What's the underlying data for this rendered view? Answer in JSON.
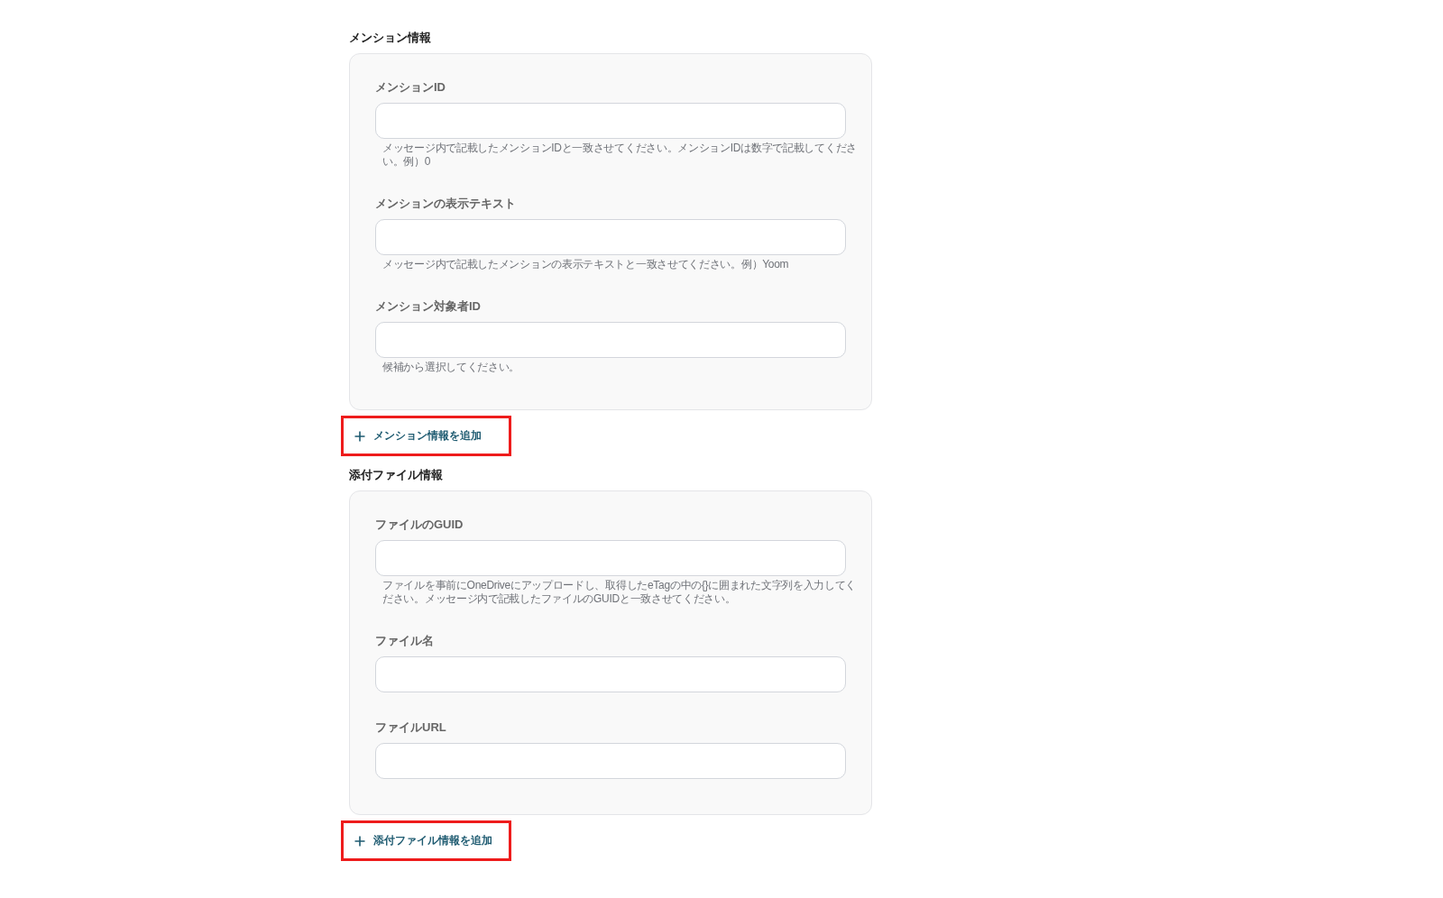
{
  "sections": [
    {
      "title": "メンション情報",
      "fields": [
        {
          "label": "メンションID",
          "hint": "メッセージ内で記載したメンションIDと一致させてください。メンションIDは数字で記載してください。例）0"
        },
        {
          "label": "メンションの表示テキスト",
          "hint": "メッセージ内で記載したメンションの表示テキストと一致させてください。例）Yoom"
        },
        {
          "label": "メンション対象者ID",
          "hint": "候補から選択してください。"
        }
      ],
      "add_button": {
        "label": "メンション情報を追加",
        "highlighted": true
      }
    },
    {
      "title": "添付ファイル情報",
      "fields": [
        {
          "label": "ファイルのGUID",
          "hint": "ファイルを事前にOneDriveにアップロードし、取得したeTagの中の{}に囲まれた文字列を入力してください。メッセージ内で記載したファイルのGUIDと一致させてください。"
        },
        {
          "label": "ファイル名"
        },
        {
          "label": "ファイルURL"
        }
      ],
      "add_button": {
        "label": "添付ファイル情報を追加",
        "highlighted": true
      }
    }
  ]
}
